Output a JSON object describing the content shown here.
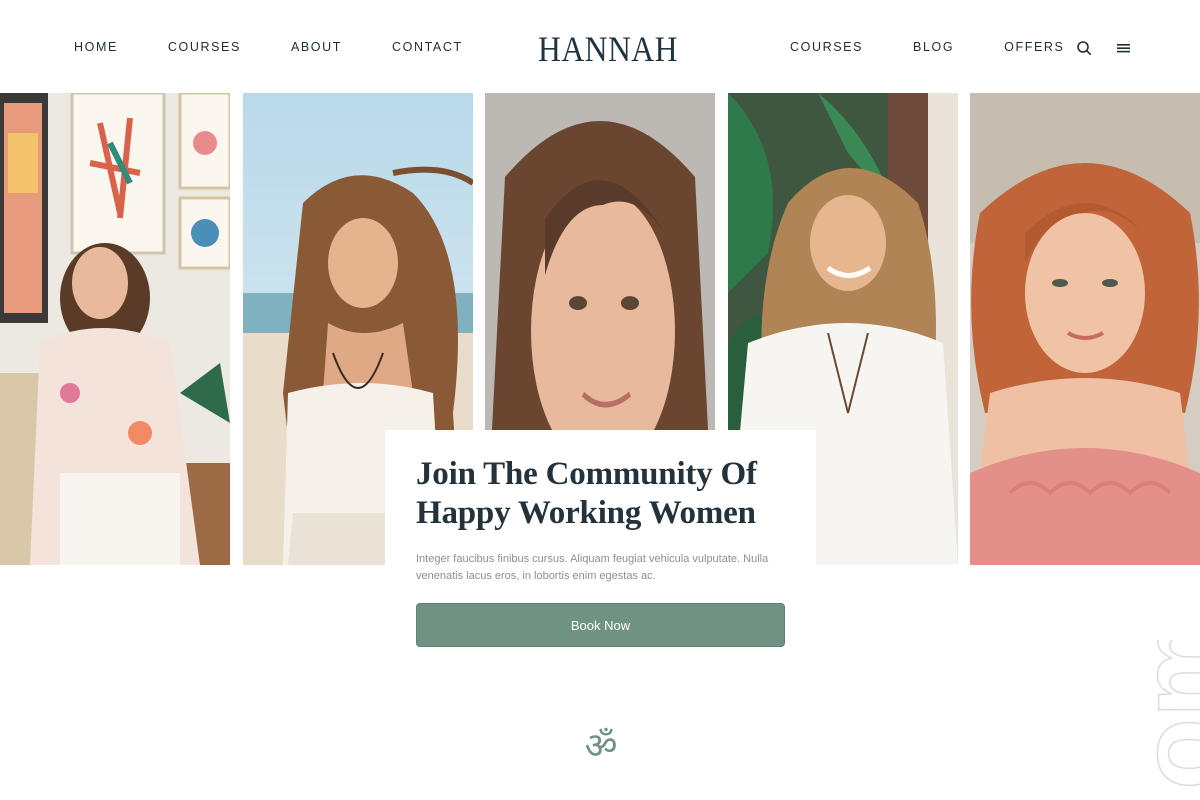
{
  "header": {
    "brand": "HANNAH",
    "nav_left": [
      {
        "label": "HOME"
      },
      {
        "label": "COURSES"
      },
      {
        "label": "ABOUT"
      },
      {
        "label": "CONTACT"
      }
    ],
    "nav_right": [
      {
        "label": "COURSES"
      },
      {
        "label": "BLOG"
      },
      {
        "label": "OFFERS"
      }
    ],
    "icons": [
      "search-icon",
      "menu-icon"
    ]
  },
  "hero": {
    "title": "Join The Community Of Happy Working Women",
    "body": "Integer faucibus finibus cursus. Aliquam feugiat vehicula vulputate. Nulla venenatis lacus eros, in lobortis enim egestas ac.",
    "cta_label": "Book Now"
  },
  "symbol": "ॐ",
  "side_word": "om",
  "colors": {
    "accent": "#6f9283",
    "text_dark": "#1f2e36",
    "muted": "#8a9094"
  }
}
